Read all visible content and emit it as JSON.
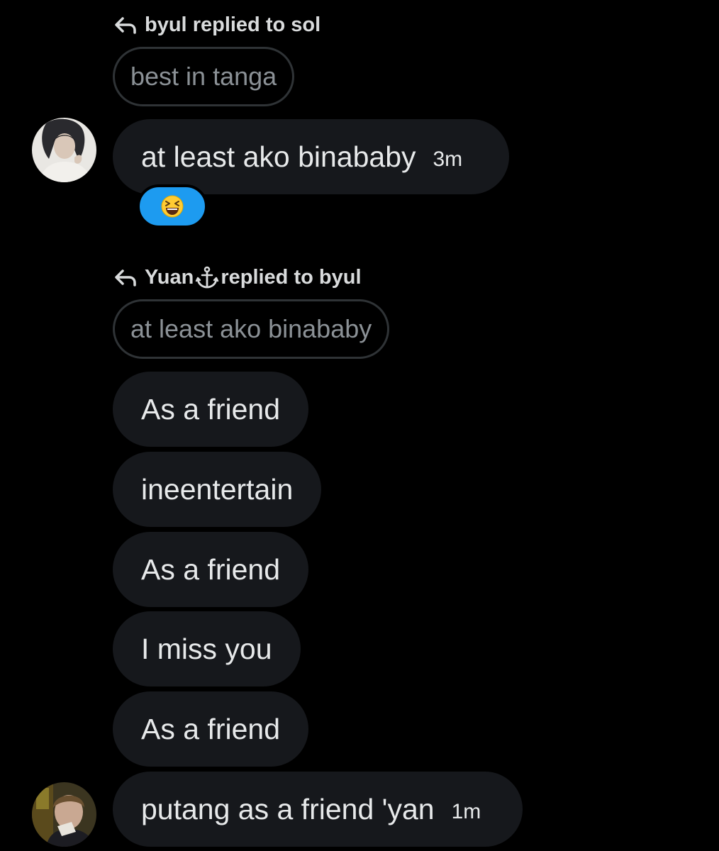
{
  "thread": [
    {
      "type": "reply_header",
      "sender": "byul",
      "connector": "replied to",
      "recipient": "sol"
    },
    {
      "type": "quoted",
      "text": "best in tanga"
    },
    {
      "type": "message",
      "text": "at least ako binababy",
      "time": "3m",
      "reaction": "grinning-squinting-face"
    },
    {
      "type": "reply_header",
      "sender": "Yuan",
      "sender_badge": "anchor-icon",
      "connector": "replied to",
      "recipient": "byul"
    },
    {
      "type": "quoted",
      "text": "at least ako binababy"
    },
    {
      "type": "message",
      "text": "As a friend"
    },
    {
      "type": "message",
      "text": "ineentertain"
    },
    {
      "type": "message",
      "text": "As a friend"
    },
    {
      "type": "message",
      "text": "I miss you"
    },
    {
      "type": "message",
      "text": "As a friend"
    },
    {
      "type": "message",
      "text": "putang as a friend 'yan",
      "time": "1m"
    }
  ],
  "colors": {
    "background": "#000000",
    "bubble": "#16181c",
    "quoted_border": "#2f3336",
    "quoted_text": "#8b9196",
    "reaction_bg": "#1d9bf0"
  }
}
